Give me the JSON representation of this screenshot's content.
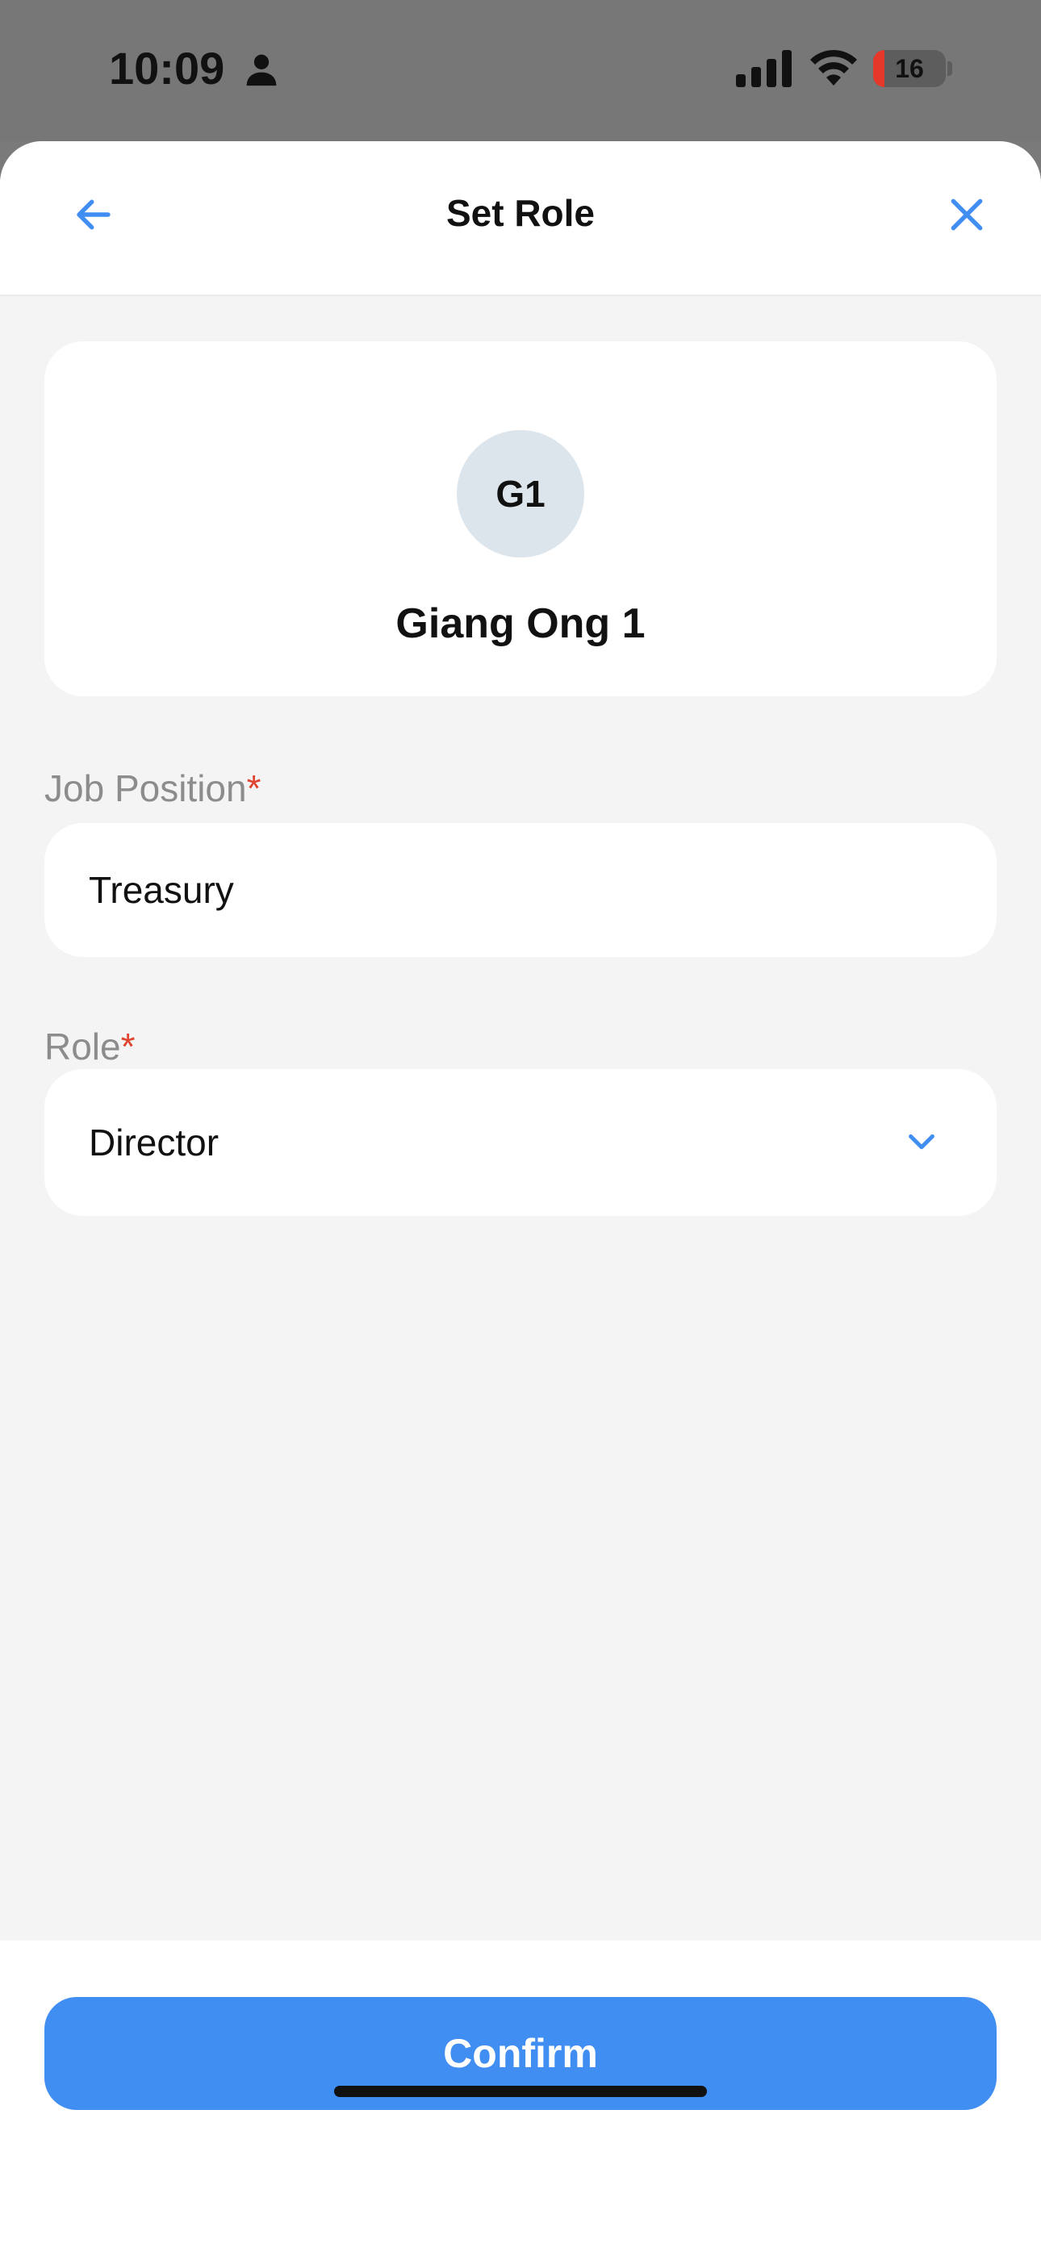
{
  "status_bar": {
    "time": "10:09",
    "battery_level": "16",
    "icons": [
      "person-icon",
      "cellular-signal-icon",
      "wifi-icon",
      "battery-icon"
    ]
  },
  "header": {
    "title": "Set Role",
    "back_icon": "arrow-left-icon",
    "close_icon": "close-icon"
  },
  "profile": {
    "initials": "G1",
    "name": "Giang Ong 1"
  },
  "form": {
    "job_position": {
      "label": "Job Position",
      "required_mark": "*",
      "value": "Treasury"
    },
    "role": {
      "label": "Role",
      "required_mark": "*",
      "value": "Director",
      "icon": "chevron-down-icon"
    }
  },
  "footer": {
    "confirm_label": "Confirm"
  },
  "colors": {
    "accent": "#418ef2",
    "required": "#e0432e",
    "label": "#8c8c8c",
    "background": "#f4f4f4",
    "avatar_bg": "#dde5ec"
  }
}
